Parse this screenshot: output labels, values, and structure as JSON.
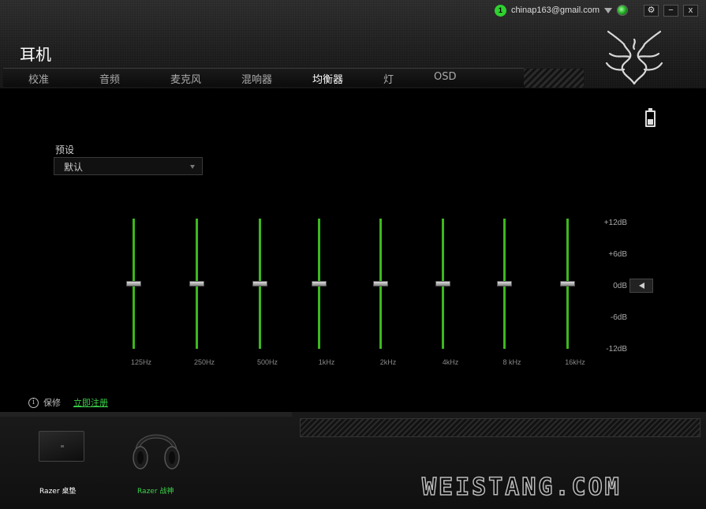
{
  "header": {
    "notification_count": "1",
    "email": "chinap163@gmail.com",
    "title": "耳机",
    "window_buttons": {
      "settings": "⚙",
      "minimize": "−",
      "close": "x"
    }
  },
  "tabs": [
    {
      "label": "校准",
      "active": false
    },
    {
      "label": "音频",
      "active": false
    },
    {
      "label": "麦克风",
      "active": false
    },
    {
      "label": "混响器",
      "active": false
    },
    {
      "label": "均衡器",
      "active": true
    },
    {
      "label": "灯",
      "active": false
    },
    {
      "label": "OSD",
      "active": false
    }
  ],
  "equalizer": {
    "preset_label": "预设",
    "preset_value": "默认",
    "bands": [
      {
        "freq": "125Hz",
        "gain_db": 0
      },
      {
        "freq": "250Hz",
        "gain_db": 0
      },
      {
        "freq": "500Hz",
        "gain_db": 0
      },
      {
        "freq": "1kHz",
        "gain_db": 0
      },
      {
        "freq": "2kHz",
        "gain_db": 0
      },
      {
        "freq": "4kHz",
        "gain_db": 0
      },
      {
        "freq": "8 kHz",
        "gain_db": 0
      },
      {
        "freq": "16kHz",
        "gain_db": 0
      }
    ],
    "db_scale": [
      "+12dB",
      "+6dB",
      "0dB",
      "-6dB",
      "-12dB"
    ],
    "range_db": [
      -12,
      12
    ]
  },
  "warranty": {
    "info_glyph": "i",
    "label": "保修",
    "register_link": "立即注册"
  },
  "devices": [
    {
      "name": "Razer 桌垫",
      "active": false
    },
    {
      "name": "Razer 战神",
      "active": true
    }
  ],
  "watermark": "WEISTANG.COM",
  "colors": {
    "accent": "#3cb81e",
    "link": "#3cd34a",
    "background": "#000000"
  }
}
